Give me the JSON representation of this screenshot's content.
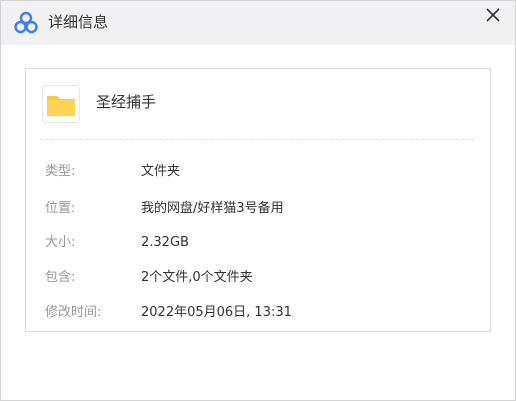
{
  "window": {
    "title": "详细信息",
    "logo_icon": "cloud-logo-icon",
    "close_icon": "close-icon"
  },
  "file": {
    "icon": "folder-icon",
    "name": "圣经捕手"
  },
  "details": [
    {
      "label": "类型:",
      "value": "文件夹"
    },
    {
      "label": "位置:",
      "value": "我的网盘/好样猫3号备用"
    },
    {
      "label": "大小:",
      "value": "2.32GB"
    },
    {
      "label": "包含:",
      "value": "2个文件,0个文件夹"
    },
    {
      "label": "修改时间:",
      "value": "2022年05月06日, 13:31"
    }
  ],
  "colors": {
    "titlebar_bg": "#f1f1f3",
    "folder_yellow": "#f9c93a",
    "logo_blue": "#3f7ef7",
    "label_gray": "#9a9a9a",
    "value_dark": "#333333"
  }
}
